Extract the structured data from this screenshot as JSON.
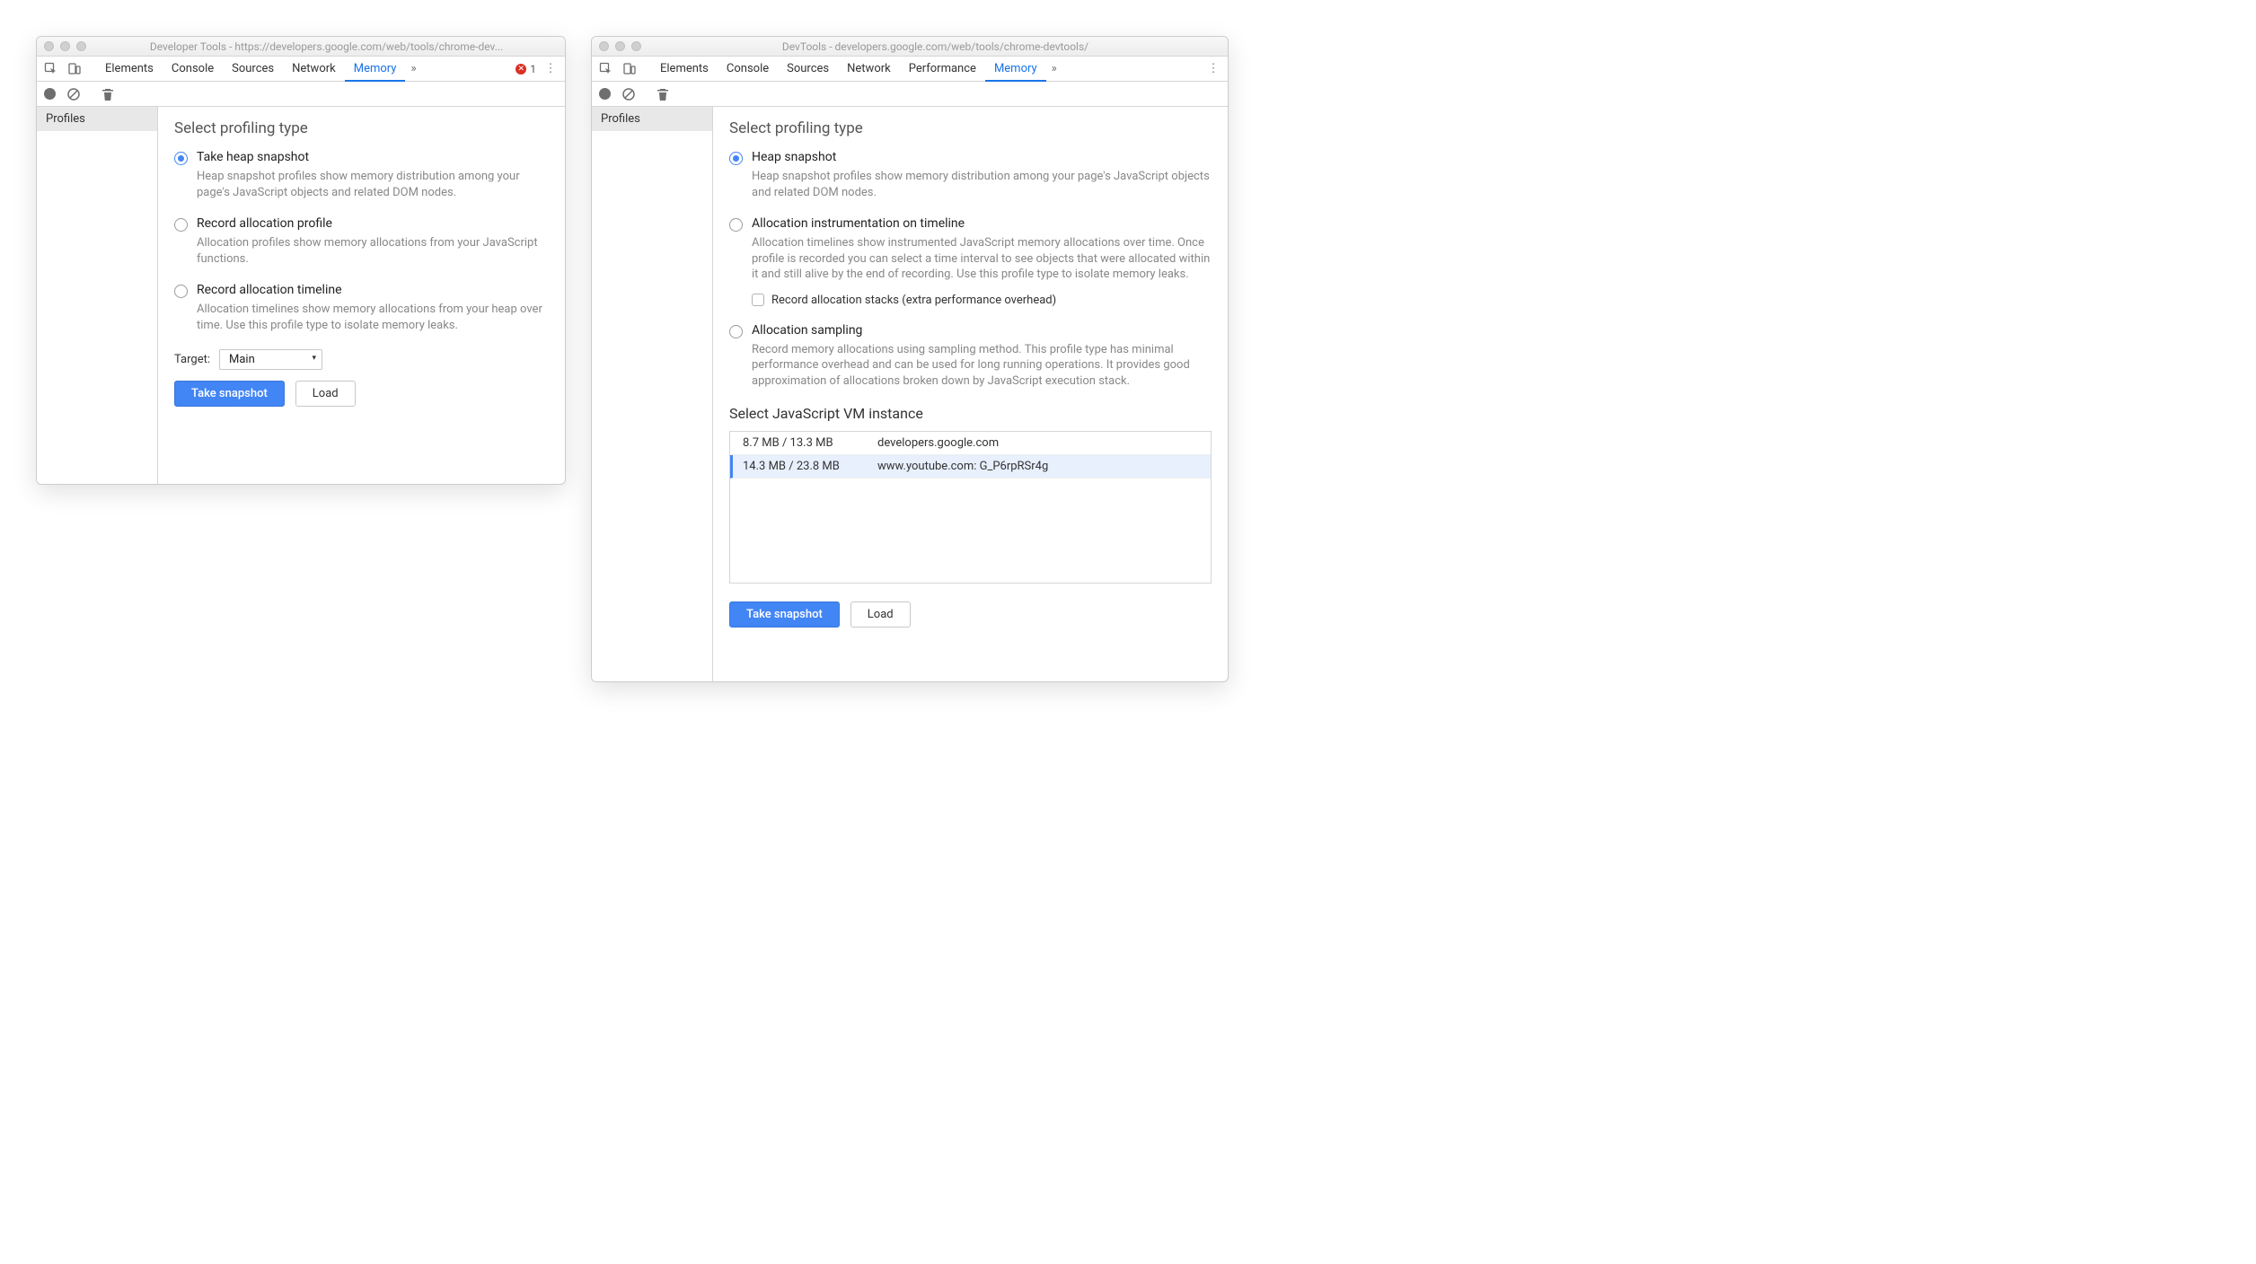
{
  "left": {
    "title": "Developer Tools - https://developers.google.com/web/tools/chrome-dev...",
    "tabs": [
      "Elements",
      "Console",
      "Sources",
      "Network",
      "Memory"
    ],
    "activeTab": "Memory",
    "errorCount": "1",
    "sidebar": {
      "profiles": "Profiles"
    },
    "section": "Select profiling type",
    "options": [
      {
        "title": "Take heap snapshot",
        "desc": "Heap snapshot profiles show memory distribution among your page's JavaScript objects and related DOM nodes.",
        "selected": true
      },
      {
        "title": "Record allocation profile",
        "desc": "Allocation profiles show memory allocations from your JavaScript functions.",
        "selected": false
      },
      {
        "title": "Record allocation timeline",
        "desc": "Allocation timelines show memory allocations from your heap over time. Use this profile type to isolate memory leaks.",
        "selected": false
      }
    ],
    "targetLabel": "Target:",
    "targetValue": "Main",
    "buttons": {
      "primary": "Take snapshot",
      "secondary": "Load"
    }
  },
  "right": {
    "title": "DevTools - developers.google.com/web/tools/chrome-devtools/",
    "tabs": [
      "Elements",
      "Console",
      "Sources",
      "Network",
      "Performance",
      "Memory"
    ],
    "activeTab": "Memory",
    "sidebar": {
      "profiles": "Profiles"
    },
    "section": "Select profiling type",
    "options": [
      {
        "title": "Heap snapshot",
        "desc": "Heap snapshot profiles show memory distribution among your page's JavaScript objects and related DOM nodes.",
        "selected": true
      },
      {
        "title": "Allocation instrumentation on timeline",
        "desc": "Allocation timelines show instrumented JavaScript memory allocations over time. Once profile is recorded you can select a time interval to see objects that were allocated within it and still alive by the end of recording. Use this profile type to isolate memory leaks.",
        "selected": false,
        "checkbox": "Record allocation stacks (extra performance overhead)"
      },
      {
        "title": "Allocation sampling",
        "desc": "Record memory allocations using sampling method. This profile type has minimal performance overhead and can be used for long running operations. It provides good approximation of allocations broken down by JavaScript execution stack.",
        "selected": false
      }
    ],
    "vmHeading": "Select JavaScript VM instance",
    "vmRows": [
      {
        "size": "8.7 MB / 13.3 MB",
        "name": "developers.google.com",
        "selected": false
      },
      {
        "size": "14.3 MB / 23.8 MB",
        "name": "www.youtube.com: G_P6rpRSr4g",
        "selected": true
      }
    ],
    "buttons": {
      "primary": "Take snapshot",
      "secondary": "Load"
    }
  }
}
